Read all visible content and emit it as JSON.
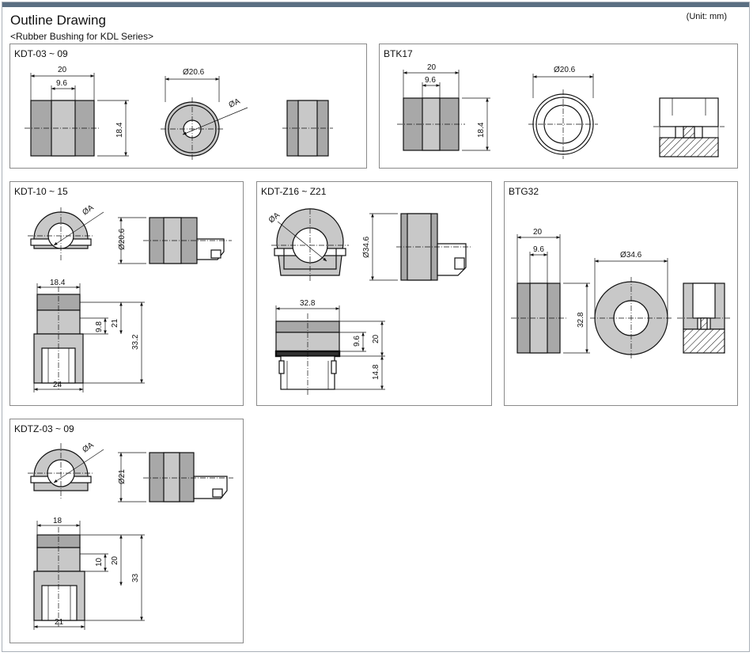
{
  "header": {
    "title": "Outline Drawing",
    "subtitle": "<Rubber Bushing for KDL Series>",
    "unit": "(Unit: mm)"
  },
  "panels": {
    "kdt0309": {
      "label": "KDT-03 ~ 09",
      "dims": {
        "width": "20",
        "inner": "9.6",
        "height": "18.4",
        "dia": "Ø20.6",
        "bore": "ØA"
      }
    },
    "btk17": {
      "label": "BTK17",
      "dims": {
        "width": "20",
        "inner": "9.6",
        "height": "18.4",
        "dia": "Ø20.6"
      }
    },
    "kdt1015": {
      "label": "KDT-10 ~ 15",
      "dims": {
        "bore": "ØA",
        "dia": "Ø20.6",
        "top": "18.4",
        "inner": "9.8",
        "h1": "21",
        "h2": "33.2",
        "bottom": "24"
      }
    },
    "kdtz1621": {
      "label": "KDT-Z16 ~ Z21",
      "dims": {
        "bore": "ØA",
        "dia": "Ø34.6",
        "top": "32.8",
        "inner": "9.6",
        "h1": "20",
        "h2": "14.8"
      }
    },
    "btg32": {
      "label": "BTG32",
      "dims": {
        "width": "20",
        "inner": "9.6",
        "height": "32.8",
        "dia": "Ø34.6"
      }
    },
    "kdtz0309": {
      "label": "KDTZ-03 ~ 09",
      "dims": {
        "bore": "ØA",
        "dia": "Ø21",
        "top": "18",
        "inner": "10",
        "h1": "20",
        "h2": "33",
        "bottom": "21"
      }
    }
  }
}
